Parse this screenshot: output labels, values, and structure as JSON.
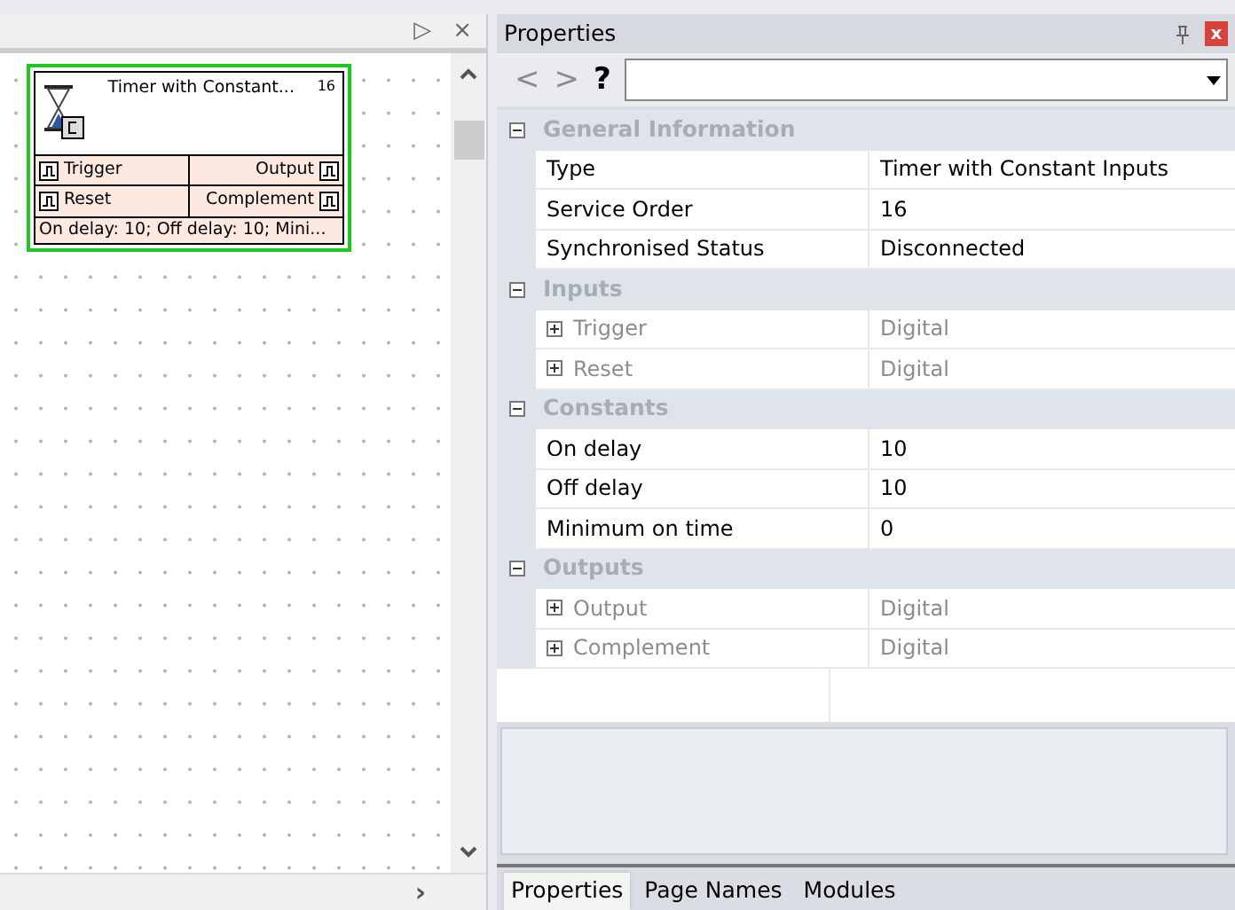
{
  "canvas": {
    "pane_buttons": [
      "▷",
      "×"
    ],
    "scroll_right": "›",
    "block": {
      "title": "Timer with Constant...",
      "order": "16",
      "selected": true,
      "ports": [
        {
          "input": "Trigger",
          "output": "Output"
        },
        {
          "input": "Reset",
          "output": "Complement"
        }
      ],
      "summary": "On delay: 10; Off delay: 10; Mini..."
    }
  },
  "properties": {
    "title": "Properties",
    "close": "x",
    "nav": [
      "<",
      ">",
      "?"
    ],
    "categories": [
      {
        "name": "General Information",
        "expanded": true,
        "rows": [
          {
            "name": "Type",
            "value": "Timer with Constant Inputs"
          },
          {
            "name": "Service Order",
            "value": "16"
          },
          {
            "name": "Synchronised Status",
            "value": "Disconnected"
          }
        ]
      },
      {
        "name": "Inputs",
        "expanded": true,
        "rows": [
          {
            "name": "Trigger",
            "value": "Digital",
            "expanded": false,
            "readonly": true
          },
          {
            "name": "Reset",
            "value": "Digital",
            "expanded": false,
            "readonly": true
          }
        ]
      },
      {
        "name": "Constants",
        "expanded": true,
        "rows": [
          {
            "name": "On delay",
            "value": "10"
          },
          {
            "name": "Off delay",
            "value": "10"
          },
          {
            "name": "Minimum on time",
            "value": "0"
          }
        ]
      },
      {
        "name": "Outputs",
        "expanded": true,
        "rows": [
          {
            "name": "Output",
            "value": "Digital",
            "expanded": false,
            "readonly": true
          },
          {
            "name": "Complement",
            "value": "Digital",
            "expanded": false,
            "readonly": true
          }
        ]
      }
    ]
  },
  "tabs": [
    {
      "label": "Properties",
      "selected": true
    },
    {
      "label": "Page Names",
      "selected": false
    },
    {
      "label": "Modules",
      "selected": false
    }
  ]
}
